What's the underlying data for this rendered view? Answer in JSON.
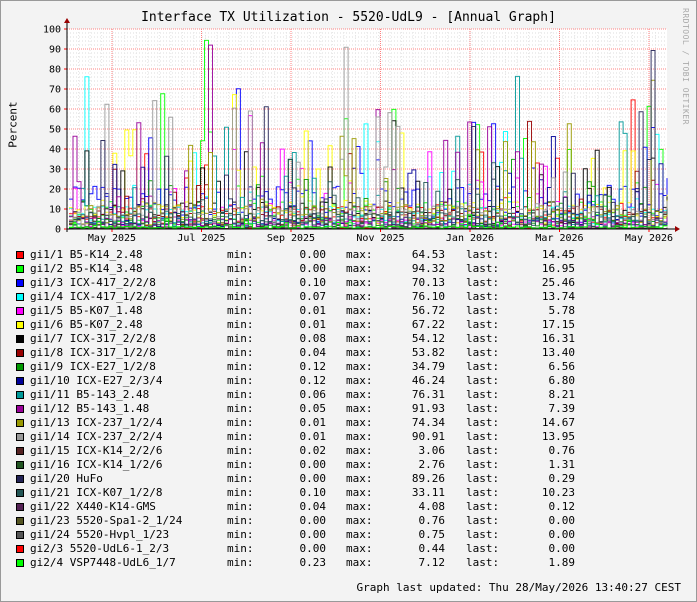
{
  "chart_data": {
    "type": "line",
    "title": "Interface TX Utilization - 5520-UdL9 - [Annual Graph]",
    "ylabel": "Percent",
    "ylim": [
      0,
      100
    ],
    "yticks": [
      "0",
      "10",
      "20",
      "30",
      "40",
      "50",
      "60",
      "70",
      "80",
      "90",
      "100"
    ],
    "xticks": [
      "May 2025",
      "Jul 2025",
      "Sep 2025",
      "Nov 2025",
      "Jan 2026",
      "Mar 2026",
      "May 2026"
    ],
    "grid": true,
    "watermark": "RRDTOOL / TOBI OETIKER",
    "series": [
      {
        "name": "gi1/1 B5-K14_2.48",
        "color": "#ff0000",
        "min": "0.00",
        "max": "64.53",
        "last": "14.45"
      },
      {
        "name": "gi1/2 B5-K14_3.48",
        "color": "#00ff00",
        "min": "0.00",
        "max": "94.32",
        "last": "16.95"
      },
      {
        "name": "gi1/3 ICX-417_2/2/8",
        "color": "#0000ff",
        "min": "0.10",
        "max": "70.13",
        "last": "25.46"
      },
      {
        "name": "gi1/4 ICX-417_1/2/8",
        "color": "#00ffff",
        "min": "0.07",
        "max": "76.10",
        "last": "13.74"
      },
      {
        "name": "gi1/5 B5-K07_1.48",
        "color": "#ff00ff",
        "min": "0.01",
        "max": "56.72",
        "last": "5.78"
      },
      {
        "name": "gi1/6 B5-K07_2.48",
        "color": "#ffff00",
        "min": "0.01",
        "max": "67.22",
        "last": "17.15"
      },
      {
        "name": "gi1/7 ICX-317_2/2/8",
        "color": "#000000",
        "min": "0.08",
        "max": "54.12",
        "last": "16.31"
      },
      {
        "name": "gi1/8 ICX-317_1/2/8",
        "color": "#990000",
        "min": "0.04",
        "max": "53.82",
        "last": "13.40"
      },
      {
        "name": "gi1/9 ICX-E27_1/2/8",
        "color": "#009900",
        "min": "0.12",
        "max": "34.79",
        "last": "6.56"
      },
      {
        "name": "gi1/10 ICX-E27_2/3/4",
        "color": "#000099",
        "min": "0.12",
        "max": "46.24",
        "last": "6.80"
      },
      {
        "name": "gi1/11 B5-143_2.48",
        "color": "#009999",
        "min": "0.06",
        "max": "76.31",
        "last": "8.21"
      },
      {
        "name": "gi1/12 B5-143_1.48",
        "color": "#990099",
        "min": "0.05",
        "max": "91.93",
        "last": "7.39"
      },
      {
        "name": "gi1/13 ICX-237_1/2/4",
        "color": "#999900",
        "min": "0.01",
        "max": "74.34",
        "last": "14.67"
      },
      {
        "name": "gi1/14 ICX-237_2/2/4",
        "color": "#999999",
        "min": "0.01",
        "max": "90.91",
        "last": "13.95"
      },
      {
        "name": "gi1/15 ICX-K14_2/2/6",
        "color": "#552222",
        "min": "0.02",
        "max": "3.06",
        "last": "0.76"
      },
      {
        "name": "gi1/16 ICX-K14_1/2/6",
        "color": "#225522",
        "min": "0.00",
        "max": "2.76",
        "last": "1.31"
      },
      {
        "name": "gi1/20 HuFo",
        "color": "#222255",
        "min": "0.00",
        "max": "89.26",
        "last": "0.29"
      },
      {
        "name": "gi1/21 ICX-K07_1/2/8",
        "color": "#225555",
        "min": "0.10",
        "max": "33.11",
        "last": "10.23"
      },
      {
        "name": "gi1/22 X440-K14-GMS",
        "color": "#552255",
        "min": "0.04",
        "max": "4.08",
        "last": "0.12"
      },
      {
        "name": "gi1/23 5520-Spa1-2_1/24",
        "color": "#555522",
        "min": "0.00",
        "max": "0.76",
        "last": "0.00"
      },
      {
        "name": "gi1/24 5520-Hvpl_1/23",
        "color": "#555555",
        "min": "0.00",
        "max": "0.75",
        "last": "0.00"
      },
      {
        "name": "gi2/3 5520-UdL6-1_2/3",
        "color": "#ff0000",
        "min": "0.00",
        "max": "0.44",
        "last": "0.00"
      },
      {
        "name": "gi2/4 VSP7448-UdL6_1/7",
        "color": "#00ff00",
        "min": "0.23",
        "max": "7.12",
        "last": "1.89"
      }
    ]
  },
  "legend_labels": {
    "min": "min:",
    "max": "max:",
    "last": "last:"
  },
  "footer": "Graph last updated: Thu 28/May/2026 13:40:27 CEST"
}
